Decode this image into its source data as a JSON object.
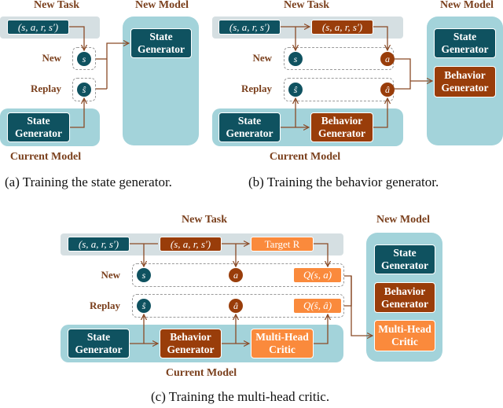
{
  "panels": {
    "a": {
      "new_task_label": "New Task",
      "new_model_label": "New Model",
      "current_model_label": "Current Model",
      "row_new": "New",
      "row_replay": "Replay",
      "tuple": "(s, a, r, s′)",
      "s": "s",
      "s_hat": "ŝ",
      "current_state_generator": "State Generator",
      "new_state_generator": "State Generator",
      "caption": "(a)  Training the state generator."
    },
    "b": {
      "new_task_label": "New Task",
      "new_model_label": "New Model",
      "current_model_label": "Current Model",
      "row_new": "New",
      "row_replay": "Replay",
      "tuple_teal": "(s, a, r, s′)",
      "tuple_rust": "(s, a, r, s′)",
      "s": "s",
      "a": "a",
      "s_hat": "ŝ",
      "a_hat": "â",
      "current_state_generator": "State Generator",
      "current_behavior_generator": "Behavior Generator",
      "new_state_generator": "State Generator",
      "new_behavior_generator": "Behavior Generator",
      "caption": "(b)  Training the behavior generator."
    },
    "c": {
      "new_task_label": "New Task",
      "new_model_label": "New Model",
      "current_model_label": "Current Model",
      "row_new": "New",
      "row_replay": "Replay",
      "tuple_teal": "(s, a, r, s′)",
      "tuple_rust": "(s, a, r, s′)",
      "target": "Target R",
      "s": "s",
      "a": "a",
      "q_new": "Q(s, a)",
      "s_hat": "ŝ",
      "a_hat": "â",
      "q_replay": "Q(ŝ, â)",
      "current_state_generator": "State Generator",
      "current_behavior_generator": "Behavior Generator",
      "current_critic": "Multi-Head Critic",
      "new_state_generator": "State Generator",
      "new_behavior_generator": "Behavior Generator",
      "new_critic": "Multi-Head Critic",
      "caption": "(c)  Training the multi-head critic."
    }
  },
  "colors": {
    "teal": "#0f5260",
    "rust": "#993d0a",
    "orange": "#fa8a3c",
    "model_band": "#a3d3da",
    "task_band": "#d5dfe2",
    "arrow": "#8a4a26",
    "label": "#7a3f1c"
  }
}
